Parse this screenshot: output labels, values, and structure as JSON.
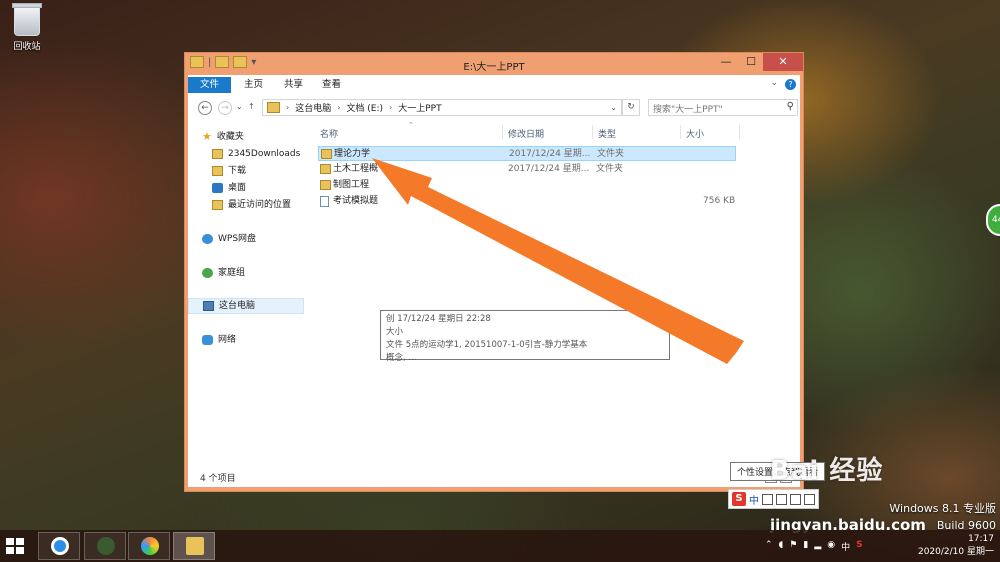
{
  "desktop": {
    "recycle_bin": "回收站"
  },
  "window": {
    "title": "E:\\大一上PPT",
    "close_glyph": "✕",
    "min_glyph": "—",
    "max_glyph": "☐",
    "ribbon_tabs": {
      "file": "文件",
      "home": "主页",
      "share": "共享",
      "view": "查看"
    },
    "help": "?",
    "address": {
      "seg1": "这台电脑",
      "seg2": "文档 (E:)",
      "seg3": "大一上PPT"
    },
    "search_placeholder": "搜索\"大一上PPT\""
  },
  "nav": {
    "favorites": "收藏夹",
    "items": [
      "2345Downloads",
      "下载",
      "桌面",
      "最近访问的位置"
    ],
    "wps": "WPS网盘",
    "homegroup": "家庭组",
    "this_pc": "这台电脑",
    "network": "网络"
  },
  "columns": {
    "name": "名称",
    "date": "修改日期",
    "type": "类型",
    "size": "大小"
  },
  "files": [
    {
      "name": "理论力学",
      "date": "2017/12/24 星期...",
      "type": "文件夹",
      "size": ""
    },
    {
      "name": "土木工程概",
      "date": "2017/12/24 星期...",
      "type": "文件夹",
      "size": ""
    },
    {
      "name": "制图工程",
      "date": "",
      "type": "",
      "size": ""
    },
    {
      "name": "考试模拟题",
      "date": "",
      "type": "",
      "size": "756 KB"
    }
  ],
  "tooltip": {
    "line1": "创    17/12/24 星期日 22:28",
    "line2": "大小",
    "line3": "文件         5点的运动学1, 20151007-1-0引言-静力学基本",
    "line4": "概念, ..."
  },
  "status": "4 个项目",
  "ime_tooltip": "个性设置，点我看看",
  "ime": {
    "s": "S",
    "zh": "中"
  },
  "watermark": {
    "logo": "Bai 经验",
    "url": "jingyan.baidu.com"
  },
  "edition": {
    "line1": "Windows 8.1 专业版",
    "line2": "Build 9600"
  },
  "side_badge": "44",
  "clock": {
    "time": "17:17",
    "date": "2020/2/10 星期一"
  },
  "tray": {
    "ime": "中",
    "sogou": "S"
  },
  "colors": {
    "accent": "#1979ca",
    "window_frame": "#f0a070",
    "arrow": "#f47a2a",
    "selection": "#cce8ff"
  }
}
